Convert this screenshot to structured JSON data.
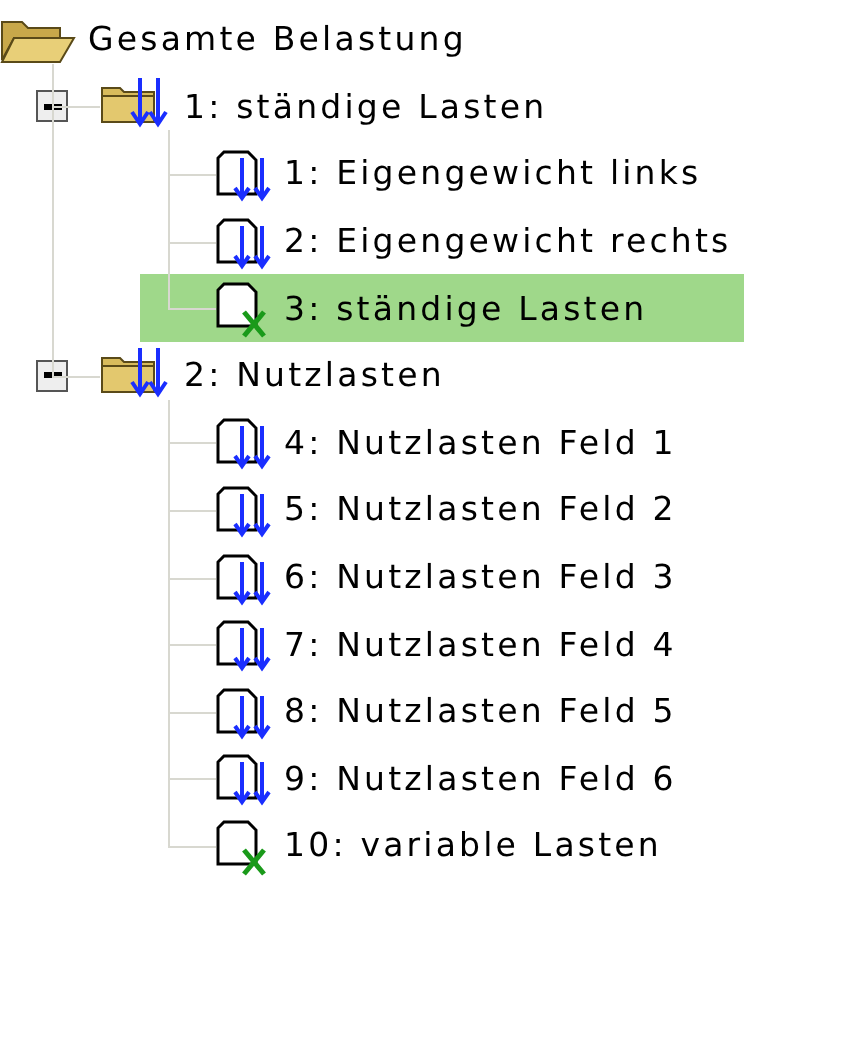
{
  "tree": {
    "label": "Gesamte Belastung",
    "kind": "root",
    "selected": false,
    "children": [
      {
        "label": "1: ständige Lasten",
        "kind": "group",
        "expanded": true,
        "selected": false,
        "children": [
          {
            "label": "1: Eigengewicht links",
            "kind": "load",
            "selected": false
          },
          {
            "label": "2: Eigengewicht rechts",
            "kind": "load",
            "selected": false
          },
          {
            "label": "3: ständige Lasten",
            "kind": "combination",
            "selected": true
          }
        ]
      },
      {
        "label": "2: Nutzlasten",
        "kind": "group",
        "expanded": true,
        "selected": false,
        "children": [
          {
            "label": "4: Nutzlasten Feld 1",
            "kind": "load",
            "selected": false
          },
          {
            "label": "5: Nutzlasten Feld 2",
            "kind": "load",
            "selected": false
          },
          {
            "label": "6: Nutzlasten Feld 3",
            "kind": "load",
            "selected": false
          },
          {
            "label": "7: Nutzlasten Feld 4",
            "kind": "load",
            "selected": false
          },
          {
            "label": "8: Nutzlasten Feld 5",
            "kind": "load",
            "selected": false
          },
          {
            "label": "9: Nutzlasten Feld 6",
            "kind": "load",
            "selected": false
          },
          {
            "label": "10: variable Lasten",
            "kind": "combination",
            "selected": false
          }
        ]
      }
    ]
  }
}
